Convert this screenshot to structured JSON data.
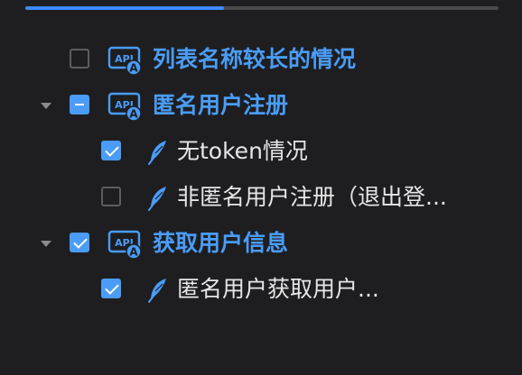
{
  "progress": {
    "fraction": 0.42
  },
  "colors": {
    "accent": "#4a9cf7",
    "background": "#1e1e20",
    "text": "#e6e6e6",
    "muted": "#8b8b8f"
  },
  "tree": {
    "items": [
      {
        "label": "列表名称较长的情况",
        "kind": "folder",
        "icon": "api-folder-icon",
        "checked": "unchecked",
        "expanded": null
      },
      {
        "label": "匿名用户注册",
        "kind": "folder",
        "icon": "api-folder-icon",
        "checked": "partial",
        "expanded": true
      },
      {
        "label": "无token情况",
        "kind": "request",
        "icon": "feather-icon",
        "checked": "checked"
      },
      {
        "label": "非匿名用户注册（退出登...",
        "kind": "request",
        "icon": "feather-icon",
        "checked": "unchecked"
      },
      {
        "label": "获取用户信息",
        "kind": "folder",
        "icon": "api-folder-icon",
        "checked": "checked",
        "expanded": true
      },
      {
        "label": "匿名用户获取用户...",
        "kind": "request",
        "icon": "feather-icon",
        "checked": "checked"
      }
    ]
  }
}
